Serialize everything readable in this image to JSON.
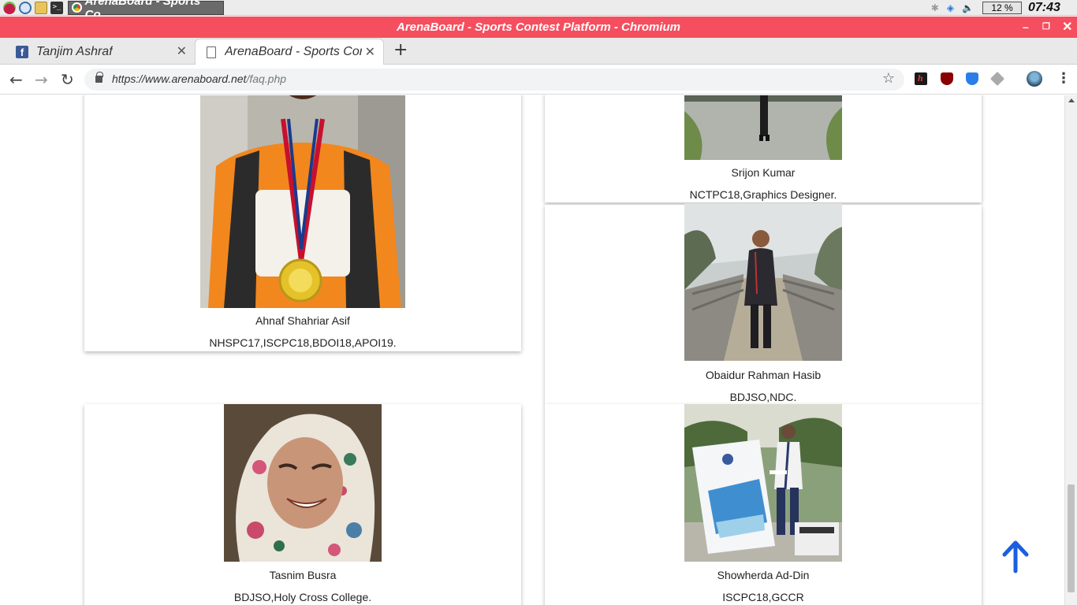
{
  "taskbar": {
    "task_title": "ArenaBoard - Sports Co...",
    "cpu": "12 %",
    "clock": "07:43"
  },
  "window": {
    "title": "ArenaBoard - Sports Contest Platform - Chromium",
    "accent": "#f54e5e"
  },
  "tabs": [
    {
      "title": "Tanjim Ashraf",
      "icon": "facebook-icon"
    },
    {
      "title": "ArenaBoard - Sports Conte",
      "icon": "document-icon"
    }
  ],
  "omnibox": {
    "url_prefix": "https://www.arenaboard.net",
    "url_path": "/faq.php"
  },
  "people": [
    {
      "name": "Ahnaf Shahriar Asif",
      "desc": "NHSPC17,ISCPC18,BDOI18,APOI19."
    },
    {
      "name": "Srijon Kumar",
      "desc": "NCTPC18,Graphics Designer."
    },
    {
      "name": "Obaidur Rahman Hasib",
      "desc": "BDJSO,NDC."
    },
    {
      "name": "Tasnim Busra",
      "desc": "BDJSO,Holy Cross College."
    },
    {
      "name": "Showherda Ad-Din",
      "desc": "ISCPC18,GCCR"
    }
  ],
  "scroll_top_color": "#1a5fe0"
}
